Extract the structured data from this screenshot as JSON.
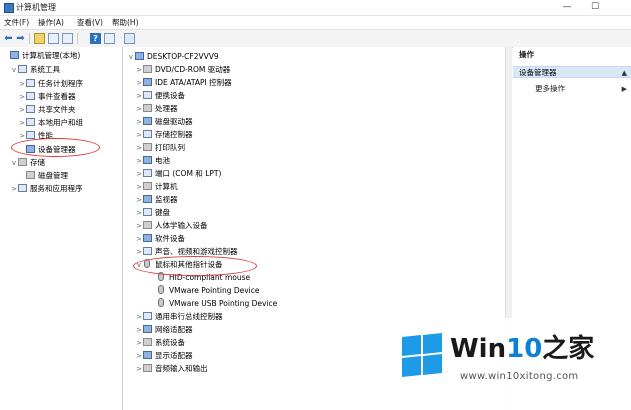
{
  "window": {
    "title": "计算机管理",
    "controls": [
      "—",
      "☐"
    ]
  },
  "menu": [
    "文件(F)",
    "操作(A)",
    "查看(V)",
    "帮助(H)"
  ],
  "toolbar": {
    "help_label": "?"
  },
  "left_tree": [
    {
      "label": "计算机管理(本地)",
      "level": 0,
      "chevron": ""
    },
    {
      "label": "系统工具",
      "level": 1,
      "chevron": "v"
    },
    {
      "label": "任务计划程序",
      "level": 2,
      "chevron": ">"
    },
    {
      "label": "事件查看器",
      "level": 2,
      "chevron": ">"
    },
    {
      "label": "共享文件夹",
      "level": 2,
      "chevron": ">"
    },
    {
      "label": "本地用户和组",
      "level": 2,
      "chevron": ">"
    },
    {
      "label": "性能",
      "level": 2,
      "chevron": ">"
    },
    {
      "label": "设备管理器",
      "level": 2,
      "chevron": ""
    },
    {
      "label": "存储",
      "level": 1,
      "chevron": "v"
    },
    {
      "label": "磁盘管理",
      "level": 2,
      "chevron": ""
    },
    {
      "label": "服务和应用程序",
      "level": 1,
      "chevron": ">"
    }
  ],
  "device_tree": {
    "root": "DESKTOP-CF2VVV9",
    "categories": [
      {
        "label": "DVD/CD-ROM 驱动器",
        "chevron": ">"
      },
      {
        "label": "IDE ATA/ATAPI 控制器",
        "chevron": ">"
      },
      {
        "label": "便携设备",
        "chevron": ">"
      },
      {
        "label": "处理器",
        "chevron": ">"
      },
      {
        "label": "磁盘驱动器",
        "chevron": ">"
      },
      {
        "label": "存储控制器",
        "chevron": ">"
      },
      {
        "label": "打印队列",
        "chevron": ">"
      },
      {
        "label": "电池",
        "chevron": ">"
      },
      {
        "label": "端口 (COM 和 LPT)",
        "chevron": ">"
      },
      {
        "label": "计算机",
        "chevron": ">"
      },
      {
        "label": "监视器",
        "chevron": ">"
      },
      {
        "label": "键盘",
        "chevron": ">"
      },
      {
        "label": "人体学输入设备",
        "chevron": ">"
      },
      {
        "label": "软件设备",
        "chevron": ">"
      },
      {
        "label": "声音、视频和游戏控制器",
        "chevron": ">"
      },
      {
        "label": "鼠标和其他指针设备",
        "chevron": "v"
      }
    ],
    "mouse_children": [
      "HID-compliant mouse",
      "VMware Pointing Device",
      "VMware USB Pointing Device"
    ],
    "after": [
      {
        "label": "通用串行总线控制器",
        "chevron": ">"
      },
      {
        "label": "网络适配器",
        "chevron": ">"
      },
      {
        "label": "系统设备",
        "chevron": ">"
      },
      {
        "label": "显示适配器",
        "chevron": ">"
      },
      {
        "label": "音频输入和输出",
        "chevron": ">"
      }
    ]
  },
  "actions": {
    "header": "操作",
    "selected": "设备管理器",
    "more": "更多操作",
    "tri_selected": "▲",
    "tri_more": "▶"
  },
  "logo": {
    "brand_prefix": "Win",
    "brand_num": "10",
    "brand_suffix": "之家",
    "url": "www.win10xitong.com",
    "color": "#1e9be6"
  }
}
